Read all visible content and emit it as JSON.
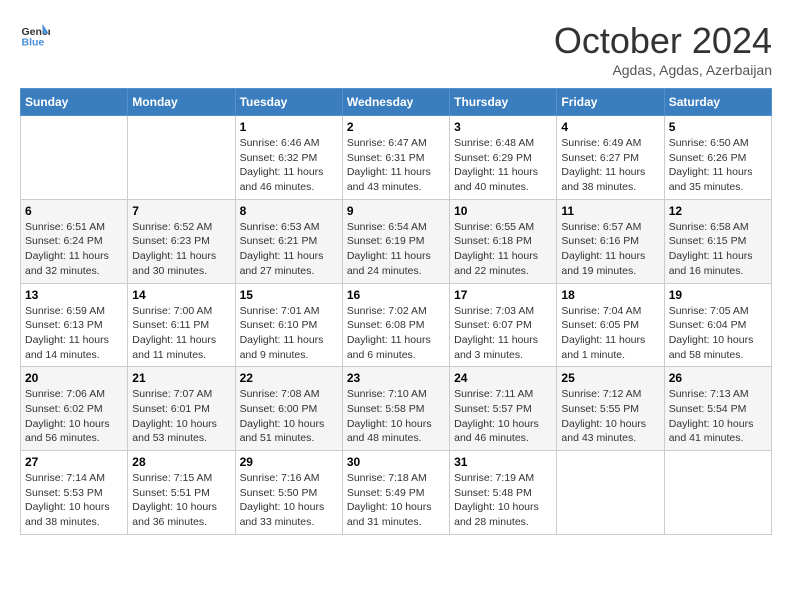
{
  "header": {
    "logo_line1": "General",
    "logo_line2": "Blue",
    "month_title": "October 2024",
    "location": "Agdas, Agdas, Azerbaijan"
  },
  "weekdays": [
    "Sunday",
    "Monday",
    "Tuesday",
    "Wednesday",
    "Thursday",
    "Friday",
    "Saturday"
  ],
  "weeks": [
    [
      {
        "day": "",
        "sunrise": "",
        "sunset": "",
        "daylight": ""
      },
      {
        "day": "",
        "sunrise": "",
        "sunset": "",
        "daylight": ""
      },
      {
        "day": "1",
        "sunrise": "Sunrise: 6:46 AM",
        "sunset": "Sunset: 6:32 PM",
        "daylight": "Daylight: 11 hours and 46 minutes."
      },
      {
        "day": "2",
        "sunrise": "Sunrise: 6:47 AM",
        "sunset": "Sunset: 6:31 PM",
        "daylight": "Daylight: 11 hours and 43 minutes."
      },
      {
        "day": "3",
        "sunrise": "Sunrise: 6:48 AM",
        "sunset": "Sunset: 6:29 PM",
        "daylight": "Daylight: 11 hours and 40 minutes."
      },
      {
        "day": "4",
        "sunrise": "Sunrise: 6:49 AM",
        "sunset": "Sunset: 6:27 PM",
        "daylight": "Daylight: 11 hours and 38 minutes."
      },
      {
        "day": "5",
        "sunrise": "Sunrise: 6:50 AM",
        "sunset": "Sunset: 6:26 PM",
        "daylight": "Daylight: 11 hours and 35 minutes."
      }
    ],
    [
      {
        "day": "6",
        "sunrise": "Sunrise: 6:51 AM",
        "sunset": "Sunset: 6:24 PM",
        "daylight": "Daylight: 11 hours and 32 minutes."
      },
      {
        "day": "7",
        "sunrise": "Sunrise: 6:52 AM",
        "sunset": "Sunset: 6:23 PM",
        "daylight": "Daylight: 11 hours and 30 minutes."
      },
      {
        "day": "8",
        "sunrise": "Sunrise: 6:53 AM",
        "sunset": "Sunset: 6:21 PM",
        "daylight": "Daylight: 11 hours and 27 minutes."
      },
      {
        "day": "9",
        "sunrise": "Sunrise: 6:54 AM",
        "sunset": "Sunset: 6:19 PM",
        "daylight": "Daylight: 11 hours and 24 minutes."
      },
      {
        "day": "10",
        "sunrise": "Sunrise: 6:55 AM",
        "sunset": "Sunset: 6:18 PM",
        "daylight": "Daylight: 11 hours and 22 minutes."
      },
      {
        "day": "11",
        "sunrise": "Sunrise: 6:57 AM",
        "sunset": "Sunset: 6:16 PM",
        "daylight": "Daylight: 11 hours and 19 minutes."
      },
      {
        "day": "12",
        "sunrise": "Sunrise: 6:58 AM",
        "sunset": "Sunset: 6:15 PM",
        "daylight": "Daylight: 11 hours and 16 minutes."
      }
    ],
    [
      {
        "day": "13",
        "sunrise": "Sunrise: 6:59 AM",
        "sunset": "Sunset: 6:13 PM",
        "daylight": "Daylight: 11 hours and 14 minutes."
      },
      {
        "day": "14",
        "sunrise": "Sunrise: 7:00 AM",
        "sunset": "Sunset: 6:11 PM",
        "daylight": "Daylight: 11 hours and 11 minutes."
      },
      {
        "day": "15",
        "sunrise": "Sunrise: 7:01 AM",
        "sunset": "Sunset: 6:10 PM",
        "daylight": "Daylight: 11 hours and 9 minutes."
      },
      {
        "day": "16",
        "sunrise": "Sunrise: 7:02 AM",
        "sunset": "Sunset: 6:08 PM",
        "daylight": "Daylight: 11 hours and 6 minutes."
      },
      {
        "day": "17",
        "sunrise": "Sunrise: 7:03 AM",
        "sunset": "Sunset: 6:07 PM",
        "daylight": "Daylight: 11 hours and 3 minutes."
      },
      {
        "day": "18",
        "sunrise": "Sunrise: 7:04 AM",
        "sunset": "Sunset: 6:05 PM",
        "daylight": "Daylight: 11 hours and 1 minute."
      },
      {
        "day": "19",
        "sunrise": "Sunrise: 7:05 AM",
        "sunset": "Sunset: 6:04 PM",
        "daylight": "Daylight: 10 hours and 58 minutes."
      }
    ],
    [
      {
        "day": "20",
        "sunrise": "Sunrise: 7:06 AM",
        "sunset": "Sunset: 6:02 PM",
        "daylight": "Daylight: 10 hours and 56 minutes."
      },
      {
        "day": "21",
        "sunrise": "Sunrise: 7:07 AM",
        "sunset": "Sunset: 6:01 PM",
        "daylight": "Daylight: 10 hours and 53 minutes."
      },
      {
        "day": "22",
        "sunrise": "Sunrise: 7:08 AM",
        "sunset": "Sunset: 6:00 PM",
        "daylight": "Daylight: 10 hours and 51 minutes."
      },
      {
        "day": "23",
        "sunrise": "Sunrise: 7:10 AM",
        "sunset": "Sunset: 5:58 PM",
        "daylight": "Daylight: 10 hours and 48 minutes."
      },
      {
        "day": "24",
        "sunrise": "Sunrise: 7:11 AM",
        "sunset": "Sunset: 5:57 PM",
        "daylight": "Daylight: 10 hours and 46 minutes."
      },
      {
        "day": "25",
        "sunrise": "Sunrise: 7:12 AM",
        "sunset": "Sunset: 5:55 PM",
        "daylight": "Daylight: 10 hours and 43 minutes."
      },
      {
        "day": "26",
        "sunrise": "Sunrise: 7:13 AM",
        "sunset": "Sunset: 5:54 PM",
        "daylight": "Daylight: 10 hours and 41 minutes."
      }
    ],
    [
      {
        "day": "27",
        "sunrise": "Sunrise: 7:14 AM",
        "sunset": "Sunset: 5:53 PM",
        "daylight": "Daylight: 10 hours and 38 minutes."
      },
      {
        "day": "28",
        "sunrise": "Sunrise: 7:15 AM",
        "sunset": "Sunset: 5:51 PM",
        "daylight": "Daylight: 10 hours and 36 minutes."
      },
      {
        "day": "29",
        "sunrise": "Sunrise: 7:16 AM",
        "sunset": "Sunset: 5:50 PM",
        "daylight": "Daylight: 10 hours and 33 minutes."
      },
      {
        "day": "30",
        "sunrise": "Sunrise: 7:18 AM",
        "sunset": "Sunset: 5:49 PM",
        "daylight": "Daylight: 10 hours and 31 minutes."
      },
      {
        "day": "31",
        "sunrise": "Sunrise: 7:19 AM",
        "sunset": "Sunset: 5:48 PM",
        "daylight": "Daylight: 10 hours and 28 minutes."
      },
      {
        "day": "",
        "sunrise": "",
        "sunset": "",
        "daylight": ""
      },
      {
        "day": "",
        "sunrise": "",
        "sunset": "",
        "daylight": ""
      }
    ]
  ]
}
